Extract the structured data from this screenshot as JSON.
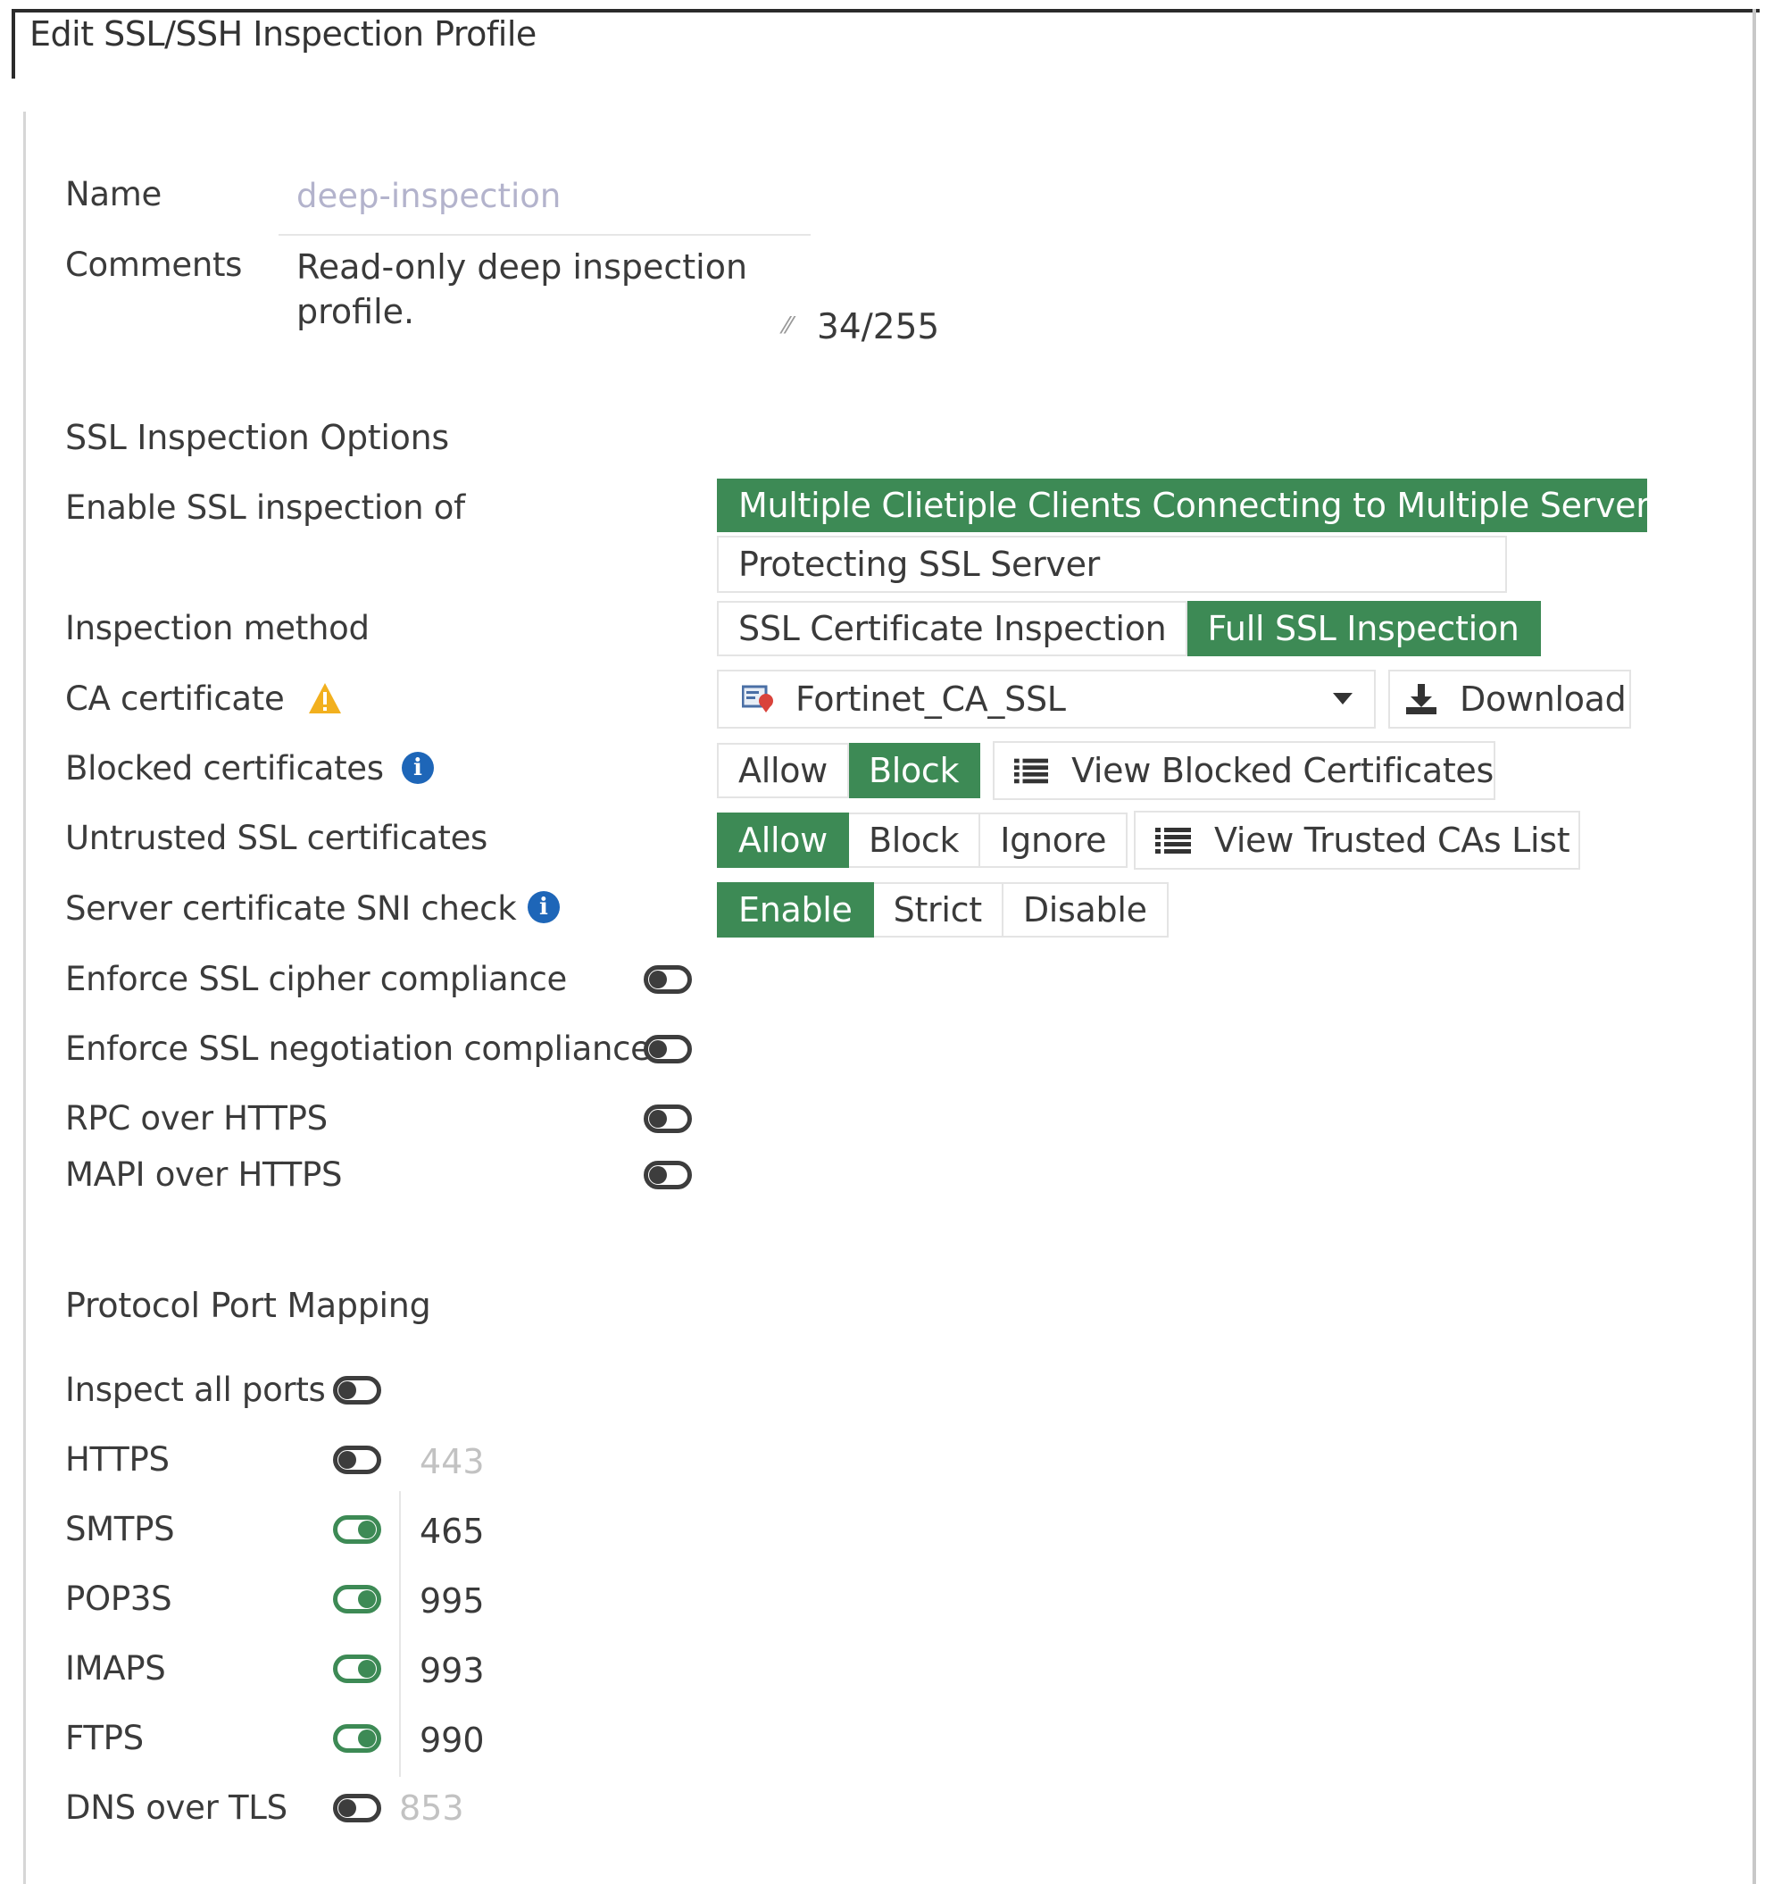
{
  "dialog": {
    "title": "Edit SSL/SSH Inspection Profile"
  },
  "name": {
    "label": "Name",
    "value": "deep-inspection"
  },
  "comments": {
    "label": "Comments",
    "value": "Read-only deep inspection profile.",
    "counter": "34/255"
  },
  "ssl_options": {
    "heading": "SSL Inspection Options",
    "enable_of": {
      "label": "Enable SSL inspection of",
      "options": [
        "Multiple Clietiple Clients Connecting to Multiple Servers",
        "Protecting SSL Server"
      ],
      "selected": "Multiple Clietiple Clients Connecting to Multiple Servers"
    },
    "inspection_method": {
      "label": "Inspection method",
      "options": [
        "SSL Certificate Inspection",
        "Full SSL Inspection"
      ],
      "selected": "Full SSL Inspection"
    },
    "ca_certificate": {
      "label": "CA certificate",
      "value": "Fortinet_CA_SSL",
      "download_label": "Download"
    },
    "blocked_certificates": {
      "label": "Blocked certificates",
      "options": [
        "Allow",
        "Block"
      ],
      "selected": "Block",
      "view_label": "View Blocked Certificates"
    },
    "untrusted_certificates": {
      "label": "Untrusted SSL certificates",
      "options": [
        "Allow",
        "Block",
        "Ignore"
      ],
      "selected": "Allow",
      "view_label": "View Trusted CAs List"
    },
    "sni_check": {
      "label": "Server certificate SNI check",
      "options": [
        "Enable",
        "Strict",
        "Disable"
      ],
      "selected": "Enable"
    },
    "toggles": [
      {
        "label": "Enforce SSL cipher compliance",
        "on": false
      },
      {
        "label": "Enforce SSL negotiation compliance",
        "on": false
      },
      {
        "label": "RPC over HTTPS",
        "on": false
      },
      {
        "label": "MAPI over HTTPS",
        "on": false
      }
    ]
  },
  "port_mapping": {
    "heading": "Protocol Port Mapping",
    "inspect_all": {
      "label": "Inspect all ports",
      "on": false
    },
    "protocols": [
      {
        "label": "HTTPS",
        "on": false,
        "port": "443"
      },
      {
        "label": "SMTPS",
        "on": true,
        "port": "465"
      },
      {
        "label": "POP3S",
        "on": true,
        "port": "995"
      },
      {
        "label": "IMAPS",
        "on": true,
        "port": "993"
      },
      {
        "label": "FTPS",
        "on": true,
        "port": "990"
      },
      {
        "label": "DNS over TLS",
        "on": false,
        "port": "853"
      }
    ]
  },
  "colors": {
    "accent": "#3d8a55",
    "info": "#1e66b8",
    "warning": "#f2b01e"
  }
}
